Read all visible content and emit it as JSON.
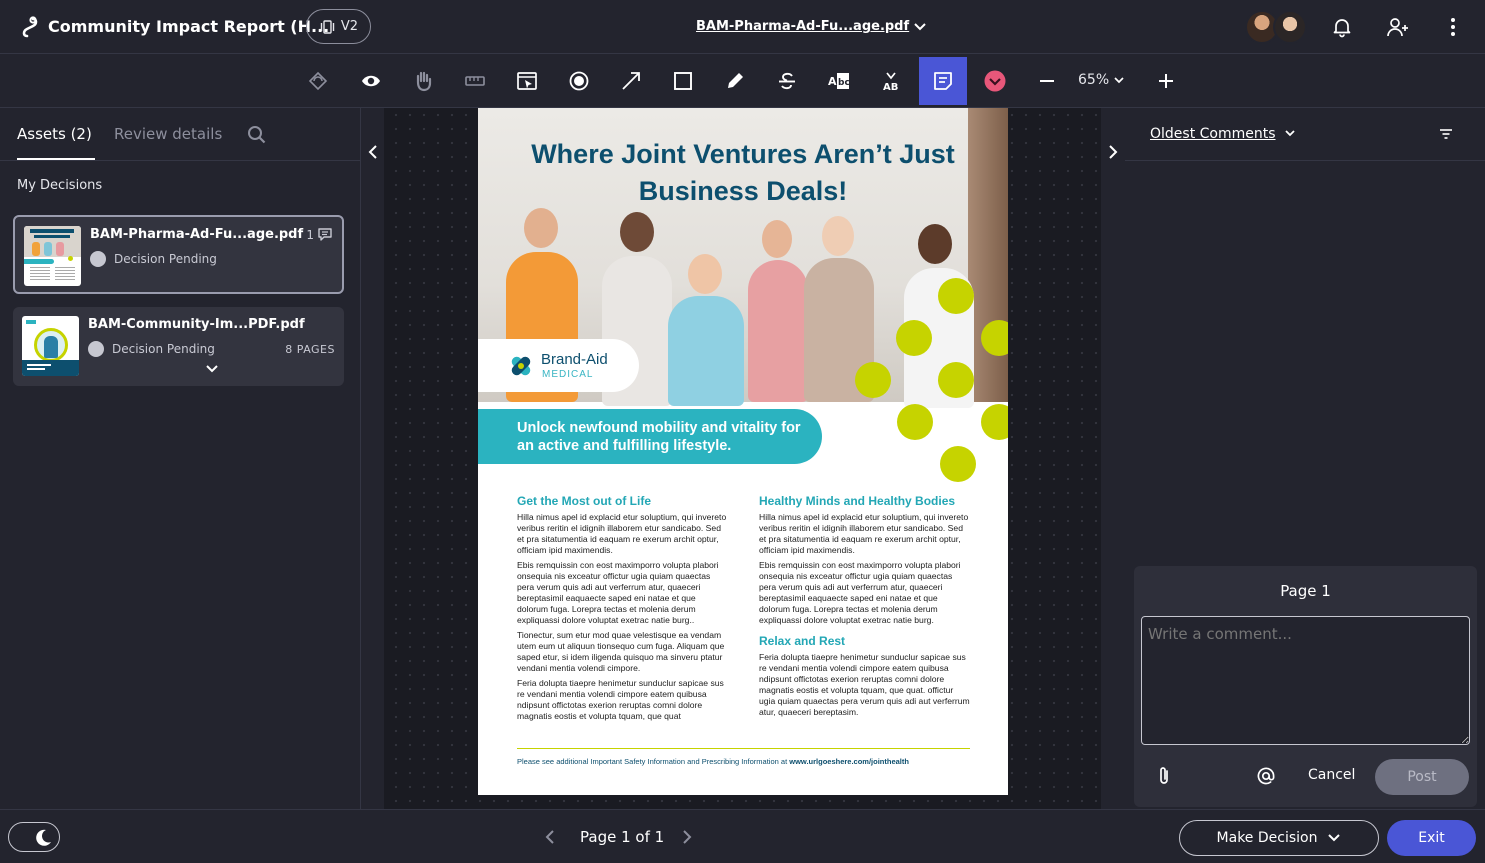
{
  "header": {
    "project_title": "Community Impact Report (H...",
    "version": "V2",
    "file_title": "BAM-Pharma-Ad-Fu...age.pdf"
  },
  "toolbar": {
    "zoom": "65%"
  },
  "left_panel": {
    "tabs": [
      {
        "label": "Assets (2)",
        "active": true
      },
      {
        "label": "Review details",
        "active": false
      }
    ],
    "section_label": "My Decisions",
    "assets": [
      {
        "name": "BAM-Pharma-Ad-Fu...age.pdf",
        "status": "Decision Pending",
        "comment_count": "1",
        "pages": ""
      },
      {
        "name": "BAM-Community-Im...PDF.pdf",
        "status": "Decision Pending",
        "comment_count": "",
        "pages": "8 PAGES"
      }
    ]
  },
  "document": {
    "headline": "Where Joint Ventures Aren’t Just Business Deals!",
    "brand_name": "Brand-Aid",
    "brand_sub": "MEDICAL",
    "banner": "Unlock newfound mobility and vitality for an active and fulfilling lifestyle.",
    "col_a_title": "Get the Most out of Life",
    "col_a_p1": "Hilla nimus apel id explacid etur soluptium, qui invereto veribus reritin el idignih illaborem etur sandicabo. Sed et pra sitatumentia id eaquam re exerum archit optur, officiam ipid maximendis.",
    "col_a_p2": "Ebis remquissin con eost maximporro volupta plabori onsequia nis exceatur offictur ugia quiam quaectas pera verum quis adi aut verferrum atur, quaeceri bereptasimil eaquaecte saped eni natae et que dolorum fuga. Lorepra tectas et molenia derum expliquassi dolore voluptat exetrac natie burg..",
    "col_a_p3": "Tionectur, sum etur mod quae velestisque ea vendam utem eum ut aliquun tionsequo cum fuga. Aliquam que saped etur, si idem iligenda quisquo ma sinveru ptatur vendani mentia volendi cimpore.",
    "col_a_p4": "Feria dolupta tiaepre henimetur sunduclur sapicae sus re vendani mentia volendi cimpore eatem quibusa ndipsunt offictotas exerion reruptas comni dolore magnatis eostis et volupta tquam, que quat",
    "col_b_title": "Healthy Minds and Healthy Bodies",
    "col_b_p1": "Hilla nimus apel id explacid etur soluptium, qui invereto veribus reritin el idignih illaborem etur sandicabo. Sed et pra sitatumentia id eaquam re exerum archit optur, officiam ipid maximendis.",
    "col_b_p2": "Ebis remquissin con eost maximporro volupta plabori onsequia nis exceatur offictur ugia quiam quaectas pera verum quis adi aut verferrum atur, quaeceri bereptasimil eaquaecte saped eni natae et que dolorum fuga. Lorepra tectas et molenia derum expliquassi dolore voluptat exetrac natie burg.",
    "col_b_title2": "Relax and Rest",
    "col_b_p3": "Feria dolupta tiaepre henimetur sunduclur sapicae sus re vendani mentia volendi cimpore eatem quibusa ndipsunt offictotas exerion reruptas comni dolore magnatis eostis et volupta tquam, que quat. offictur ugia quiam quaectas pera verum quis adi aut verferrum atur, quaeceri bereptasim.",
    "footer_text": "Please see additional Important Safety Information and Prescribing Information at ",
    "footer_link": "www.urlgoeshere.com/jointhealth"
  },
  "right_panel": {
    "sort_label": "Oldest Comments",
    "composer_page": "Page 1",
    "comment_placeholder": "Write a comment...",
    "cancel_label": "Cancel",
    "post_label": "Post"
  },
  "footer": {
    "page_label": "Page 1 of 1",
    "decision_label": "Make Decision",
    "exit_label": "Exit"
  },
  "colors": {
    "accent": "#4a56d6",
    "brand_teal": "#2bb3c0",
    "brand_navy": "#0d4f6e",
    "brand_lime": "#c6d300"
  }
}
